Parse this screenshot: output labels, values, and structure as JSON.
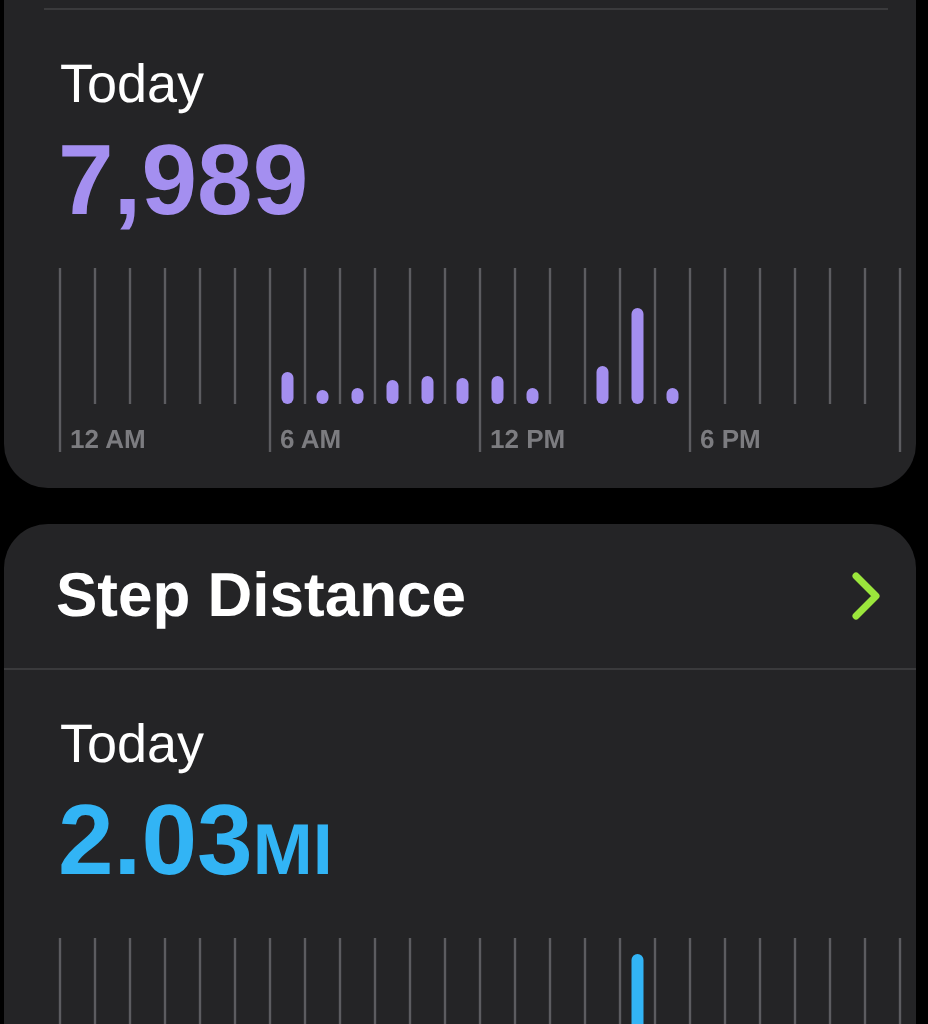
{
  "cards": [
    {
      "period": "Today",
      "value": "7,989",
      "color": "#a48ff0",
      "axis_labels": [
        "12 AM",
        "6 AM",
        "12 PM",
        "6 PM"
      ]
    },
    {
      "title": "Step Distance",
      "period": "Today",
      "value": "2.03",
      "unit": "MI",
      "color": "#32b4f5"
    }
  ]
}
